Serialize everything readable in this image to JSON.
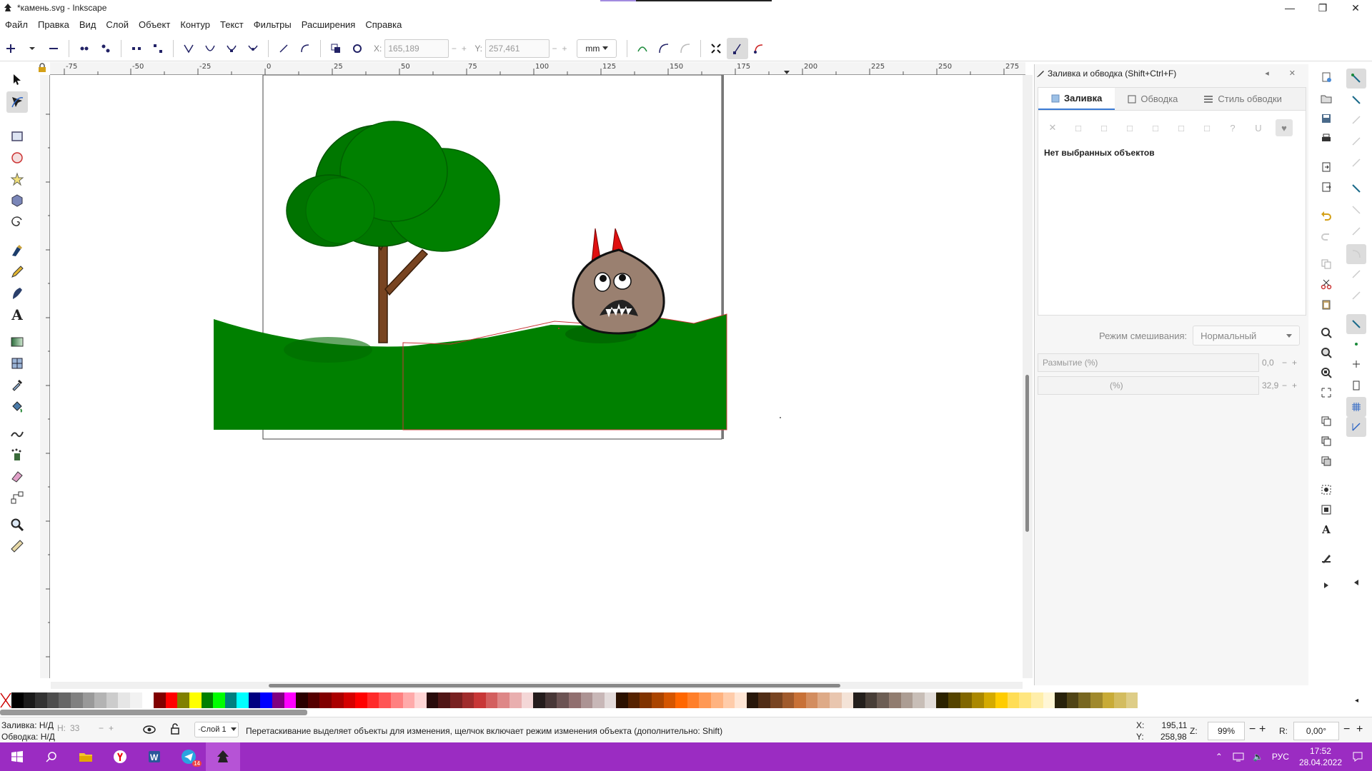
{
  "window": {
    "title": "*камень.svg - Inkscape",
    "controls": [
      "—",
      "❐",
      "✕"
    ]
  },
  "menu": [
    "Файл",
    "Правка",
    "Вид",
    "Слой",
    "Объект",
    "Контур",
    "Текст",
    "Фильтры",
    "Расширения",
    "Справка"
  ],
  "toolbar": {
    "x_label": "X:",
    "x_value": "165,189",
    "y_label": "Y:",
    "y_value": "257,461",
    "unit": "mm"
  },
  "ruler": {
    "h_ticks": [
      "-75",
      "-50",
      "-25",
      "0",
      "25",
      "50",
      "75",
      "100",
      "125",
      "150",
      "175",
      "200",
      "225",
      "250",
      "275"
    ]
  },
  "panel": {
    "title": "Заливка и обводка (Shift+Ctrl+F)",
    "tabs": [
      "Заливка",
      "Обводка",
      "Стиль обводки"
    ],
    "fill_types": [
      "✕",
      "□",
      "□",
      "□",
      "□",
      "□",
      "□",
      "?",
      "U",
      "♥"
    ],
    "no_selection": "Нет выбранных объектов",
    "blend_label": "Режим смешивания:",
    "blend_value": "Нормальный",
    "blur_label": "Размытие (%)",
    "blur_value": "0,0",
    "opacity_label": "(%)",
    "opacity_value": "32,9"
  },
  "palette_colors": [
    "#000000",
    "#1a1a1a",
    "#333333",
    "#4d4d4d",
    "#666666",
    "#808080",
    "#999999",
    "#b3b3b3",
    "#cccccc",
    "#e6e6e6",
    "#f2f2f2",
    "#ffffff",
    "#800000",
    "#ff0000",
    "#808000",
    "#ffff00",
    "#008000",
    "#00ff00",
    "#008080",
    "#00ffff",
    "#000080",
    "#0000ff",
    "#800080",
    "#ff00ff",
    "#2b0000",
    "#550000",
    "#800000",
    "#aa0000",
    "#d40000",
    "#ff0000",
    "#ff2a2a",
    "#ff5555",
    "#ff8080",
    "#ffaaaa",
    "#ffd5d5",
    "#280b0b",
    "#501616",
    "#782121",
    "#a02c2c",
    "#c83737",
    "#d35f5f",
    "#de8787",
    "#e9afaf",
    "#f4d7d7",
    "#241c1c",
    "#483737",
    "#6c5353",
    "#916f6f",
    "#ac9393",
    "#c8b7b7",
    "#e3dbdb",
    "#2b1100",
    "#552200",
    "#803300",
    "#aa4400",
    "#d45500",
    "#ff6600",
    "#ff7f2a",
    "#ff9955",
    "#ffb380",
    "#ffccaa",
    "#ffe6d5",
    "#28170b",
    "#502d16",
    "#784421",
    "#a05a2c",
    "#c87137",
    "#d38d5f",
    "#deaa87",
    "#e9c6af",
    "#f4e3d7",
    "#241f1c",
    "#483e37",
    "#6c5d53",
    "#917c6f",
    "#ac9d93",
    "#c8beb7",
    "#e3dedb",
    "#2b2200",
    "#554400",
    "#806600",
    "#aa8800",
    "#d4aa00",
    "#ffcc00",
    "#ffdd55",
    "#ffe680",
    "#ffeeaa",
    "#fff6d5",
    "#28220b",
    "#504416",
    "#786721",
    "#a0892c",
    "#c8ab37",
    "#d3bc5f",
    "#decd87"
  ],
  "status": {
    "fill_label": "Заливка:",
    "fill_value": "Н/Д",
    "stroke_label": "Обводка:",
    "stroke_value": "Н/Д",
    "h_label": "Н:",
    "h_value": "33",
    "layer": "·Слой 1",
    "message": "Перетаскивание выделяет объекты для изменения, щелчок включает режим изменения объекта (дополнительно: Shift)",
    "cursor_x_label": "X:",
    "cursor_x": "195,11",
    "cursor_y_label": "Y:",
    "cursor_y": "258,98",
    "zoom_label": "Z:",
    "zoom": "99%",
    "rotate_label": "R:",
    "rotate": "0,00°"
  },
  "taskbar": {
    "lang": "РУС",
    "time": "17:52",
    "date": "28.04.2022",
    "telegram_badge": "14"
  }
}
